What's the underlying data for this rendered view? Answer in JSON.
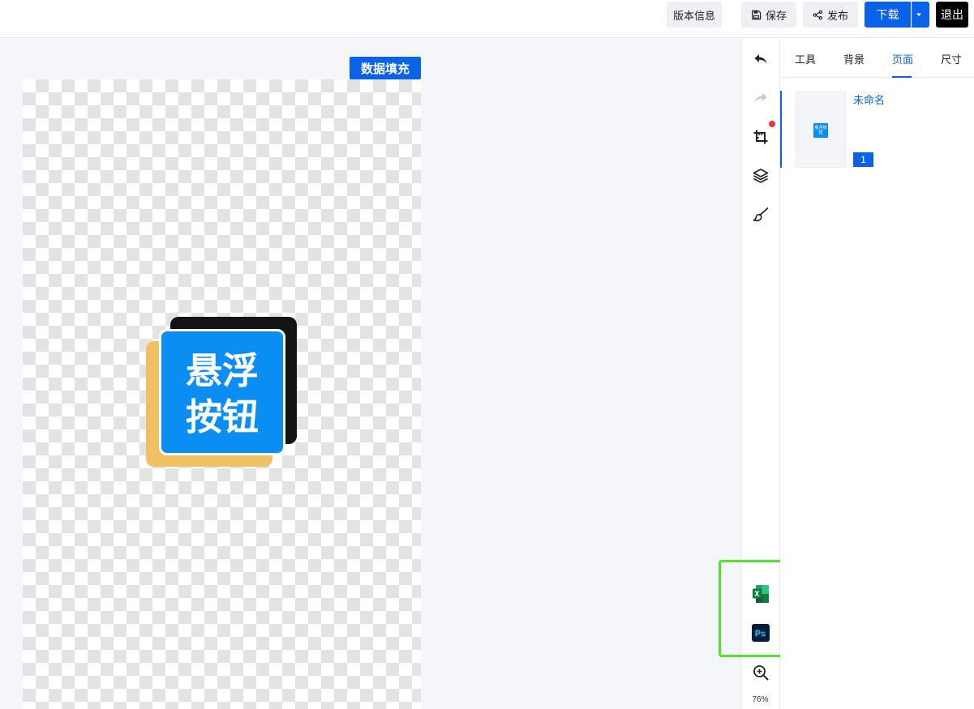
{
  "topbar": {
    "version_label": "版本信息",
    "save_label": "保存",
    "publish_label": "发布",
    "download_label": "下载",
    "exit_label": "退出"
  },
  "canvas": {
    "datafill_label": "数据填充",
    "card_line1": "悬浮",
    "card_line2": "按钮"
  },
  "tools": {
    "icons": [
      "undo-icon",
      "redo-icon",
      "crop-icon",
      "layers-icon",
      "brush-icon",
      "excel-icon",
      "photoshop-icon",
      "zoom-in-icon"
    ],
    "zoom_level": "76%"
  },
  "panel": {
    "tabs": [
      "工具",
      "背景",
      "页面",
      "尺寸"
    ],
    "active_tab": "页面",
    "pages": [
      {
        "name": "未命名",
        "number": "1",
        "thumb_text": "悬浮按钮"
      }
    ]
  },
  "colors": {
    "accent": "#0a62e8",
    "card_blue": "#0b8ef4",
    "card_yellow": "#f0c163",
    "card_black": "#141414",
    "highlight": "#55e130",
    "notify_dot": "#f2333f"
  }
}
